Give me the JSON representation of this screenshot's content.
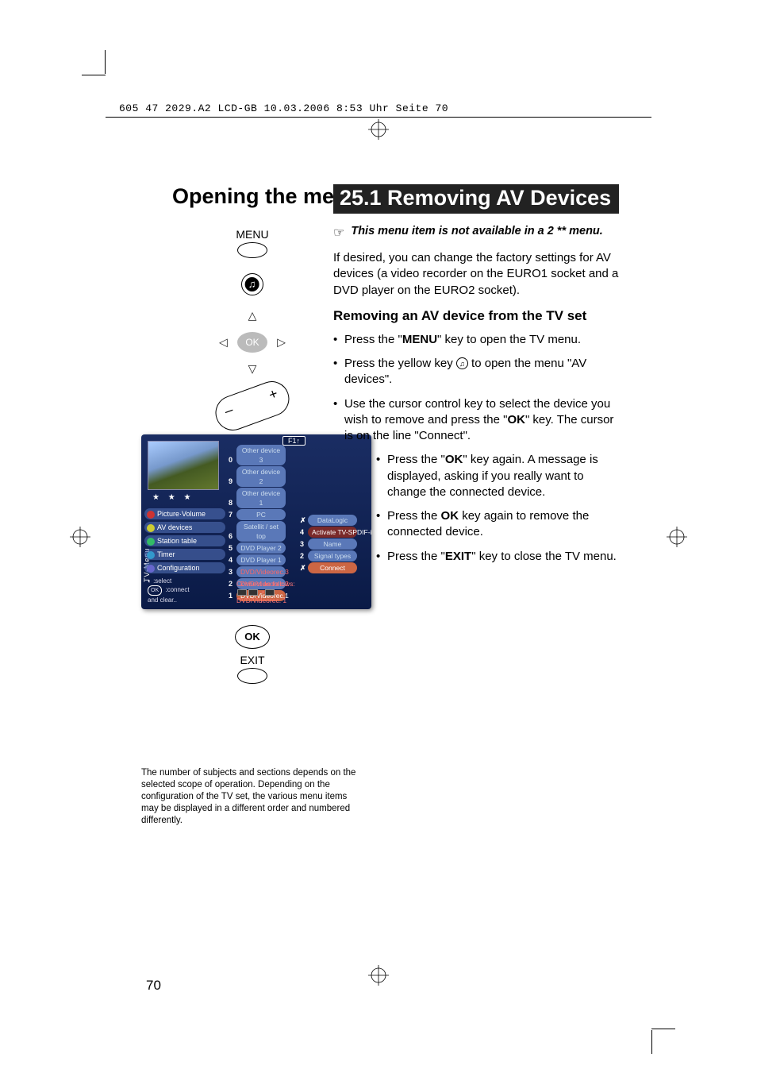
{
  "meta": {
    "header_line": "605 47 2029.A2 LCD-GB  10.03.2006  8:53 Uhr  Seite 70",
    "page_number": "70"
  },
  "headings": {
    "left": "Opening the menu",
    "right": "25.1 Removing AV Devices",
    "sub": "Removing an AV device from the TV set"
  },
  "remote": {
    "menu_label": "MENU",
    "ok_label": "OK",
    "exit_label": "EXIT",
    "ok_btn": "OK"
  },
  "note": {
    "hand": "☞",
    "text": "This menu item is not available in a 2 ** menu."
  },
  "intro": "If desired, you can change the factory settings for AV devices (a video recorder on the EURO1 socket and a DVD player on the EURO2 socket).",
  "steps": {
    "a": [
      "Press the \"",
      "MENU",
      "\" key to open the TV menu."
    ],
    "b": [
      "Press the yellow key ",
      " to open the menu \"AV devices\"."
    ],
    "b_icon": "♫",
    "c": [
      "Use the cursor control key to select the device you wish to remove and press the \"",
      "OK",
      "\" key. The cursor is on the line \"Connect\"."
    ],
    "d": [
      "Press the \"",
      "OK",
      "\" key again. A message is displayed, asking if you really want to change the connected device."
    ],
    "e": [
      "Press the ",
      "OK",
      " key again to remove the connected device."
    ],
    "f": [
      "Press the \"",
      "EXIT",
      "\" key to close the TV menu."
    ]
  },
  "osd": {
    "f1": "F1↑",
    "vlabel": "TV-Menu",
    "stars": "★ ★ ★",
    "side": [
      {
        "label": "Picture·Volume",
        "color": "red"
      },
      {
        "label": "AV devices",
        "color": "yellow"
      },
      {
        "label": "Station table",
        "color": "green"
      },
      {
        "label": "Timer",
        "color": "blue"
      },
      {
        "label": "Configuration",
        "color": "purple"
      }
    ],
    "col2": [
      {
        "n": "0",
        "label": "Other device 3"
      },
      {
        "n": "9",
        "label": "Other device 2"
      },
      {
        "n": "8",
        "label": "Other device 1"
      },
      {
        "n": "7",
        "label": "PC"
      },
      {
        "n": "6",
        "label": "Satellit / set top"
      },
      {
        "n": "5",
        "label": "DVD Player 2"
      },
      {
        "n": "4",
        "label": "DVD Player 1"
      },
      {
        "n": "3",
        "label": "DVD/Videorec.3",
        "red": true
      },
      {
        "n": "2",
        "label": "DVD/Videorec.2",
        "red": true
      },
      {
        "n": "1",
        "label": "DVD/Videorec.1",
        "sel": true
      }
    ],
    "col3": [
      {
        "n": "✗",
        "label": "DataLogic"
      },
      {
        "n": "4",
        "label": "Activate TV-SPDIF-inp",
        "redbg": true
      },
      {
        "n": "3",
        "label": "Name"
      },
      {
        "n": "2",
        "label": "Signal types"
      },
      {
        "n": "✗",
        "label": "Connect",
        "sel": true
      }
    ],
    "hint": {
      "sel": ":select",
      "ok": "OK",
      "con": ":connect",
      "clr": "and clear.."
    },
    "footer": {
      "text": "Connect as follows:",
      "device": "DVD/Videorec. 1"
    }
  },
  "footnote": "The number of subjects and sections depends on the selected scope of operation. Depending on the configuration of the TV set, the various menu items may be displayed in a different order and numbered differently."
}
